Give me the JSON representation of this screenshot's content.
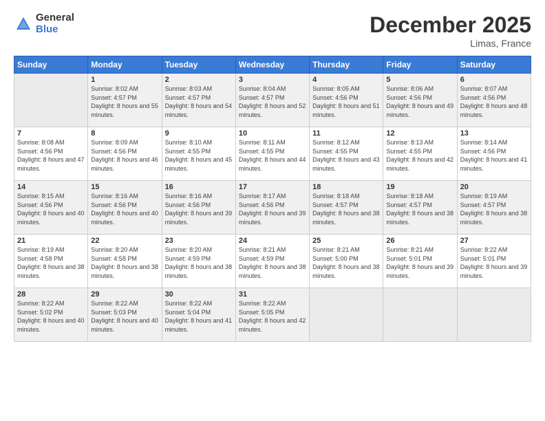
{
  "logo": {
    "general": "General",
    "blue": "Blue"
  },
  "header": {
    "month": "December 2025",
    "location": "Limas, France"
  },
  "weekdays": [
    "Sunday",
    "Monday",
    "Tuesday",
    "Wednesday",
    "Thursday",
    "Friday",
    "Saturday"
  ],
  "weeks": [
    [
      {
        "day": "",
        "sunrise": "",
        "sunset": "",
        "daylight": "",
        "empty": true
      },
      {
        "day": "1",
        "sunrise": "Sunrise: 8:02 AM",
        "sunset": "Sunset: 4:57 PM",
        "daylight": "Daylight: 8 hours and 55 minutes."
      },
      {
        "day": "2",
        "sunrise": "Sunrise: 8:03 AM",
        "sunset": "Sunset: 4:57 PM",
        "daylight": "Daylight: 8 hours and 54 minutes."
      },
      {
        "day": "3",
        "sunrise": "Sunrise: 8:04 AM",
        "sunset": "Sunset: 4:57 PM",
        "daylight": "Daylight: 8 hours and 52 minutes."
      },
      {
        "day": "4",
        "sunrise": "Sunrise: 8:05 AM",
        "sunset": "Sunset: 4:56 PM",
        "daylight": "Daylight: 8 hours and 51 minutes."
      },
      {
        "day": "5",
        "sunrise": "Sunrise: 8:06 AM",
        "sunset": "Sunset: 4:56 PM",
        "daylight": "Daylight: 8 hours and 49 minutes."
      },
      {
        "day": "6",
        "sunrise": "Sunrise: 8:07 AM",
        "sunset": "Sunset: 4:56 PM",
        "daylight": "Daylight: 8 hours and 48 minutes."
      }
    ],
    [
      {
        "day": "7",
        "sunrise": "Sunrise: 8:08 AM",
        "sunset": "Sunset: 4:56 PM",
        "daylight": "Daylight: 8 hours and 47 minutes."
      },
      {
        "day": "8",
        "sunrise": "Sunrise: 8:09 AM",
        "sunset": "Sunset: 4:56 PM",
        "daylight": "Daylight: 8 hours and 46 minutes."
      },
      {
        "day": "9",
        "sunrise": "Sunrise: 8:10 AM",
        "sunset": "Sunset: 4:55 PM",
        "daylight": "Daylight: 8 hours and 45 minutes."
      },
      {
        "day": "10",
        "sunrise": "Sunrise: 8:11 AM",
        "sunset": "Sunset: 4:55 PM",
        "daylight": "Daylight: 8 hours and 44 minutes."
      },
      {
        "day": "11",
        "sunrise": "Sunrise: 8:12 AM",
        "sunset": "Sunset: 4:55 PM",
        "daylight": "Daylight: 8 hours and 43 minutes."
      },
      {
        "day": "12",
        "sunrise": "Sunrise: 8:13 AM",
        "sunset": "Sunset: 4:55 PM",
        "daylight": "Daylight: 8 hours and 42 minutes."
      },
      {
        "day": "13",
        "sunrise": "Sunrise: 8:14 AM",
        "sunset": "Sunset: 4:56 PM",
        "daylight": "Daylight: 8 hours and 41 minutes."
      }
    ],
    [
      {
        "day": "14",
        "sunrise": "Sunrise: 8:15 AM",
        "sunset": "Sunset: 4:56 PM",
        "daylight": "Daylight: 8 hours and 40 minutes."
      },
      {
        "day": "15",
        "sunrise": "Sunrise: 8:16 AM",
        "sunset": "Sunset: 4:56 PM",
        "daylight": "Daylight: 8 hours and 40 minutes."
      },
      {
        "day": "16",
        "sunrise": "Sunrise: 8:16 AM",
        "sunset": "Sunset: 4:56 PM",
        "daylight": "Daylight: 8 hours and 39 minutes."
      },
      {
        "day": "17",
        "sunrise": "Sunrise: 8:17 AM",
        "sunset": "Sunset: 4:56 PM",
        "daylight": "Daylight: 8 hours and 39 minutes."
      },
      {
        "day": "18",
        "sunrise": "Sunrise: 8:18 AM",
        "sunset": "Sunset: 4:57 PM",
        "daylight": "Daylight: 8 hours and 38 minutes."
      },
      {
        "day": "19",
        "sunrise": "Sunrise: 8:18 AM",
        "sunset": "Sunset: 4:57 PM",
        "daylight": "Daylight: 8 hours and 38 minutes."
      },
      {
        "day": "20",
        "sunrise": "Sunrise: 8:19 AM",
        "sunset": "Sunset: 4:57 PM",
        "daylight": "Daylight: 8 hours and 38 minutes."
      }
    ],
    [
      {
        "day": "21",
        "sunrise": "Sunrise: 8:19 AM",
        "sunset": "Sunset: 4:58 PM",
        "daylight": "Daylight: 8 hours and 38 minutes."
      },
      {
        "day": "22",
        "sunrise": "Sunrise: 8:20 AM",
        "sunset": "Sunset: 4:58 PM",
        "daylight": "Daylight: 8 hours and 38 minutes."
      },
      {
        "day": "23",
        "sunrise": "Sunrise: 8:20 AM",
        "sunset": "Sunset: 4:59 PM",
        "daylight": "Daylight: 8 hours and 38 minutes."
      },
      {
        "day": "24",
        "sunrise": "Sunrise: 8:21 AM",
        "sunset": "Sunset: 4:59 PM",
        "daylight": "Daylight: 8 hours and 38 minutes."
      },
      {
        "day": "25",
        "sunrise": "Sunrise: 8:21 AM",
        "sunset": "Sunset: 5:00 PM",
        "daylight": "Daylight: 8 hours and 38 minutes."
      },
      {
        "day": "26",
        "sunrise": "Sunrise: 8:21 AM",
        "sunset": "Sunset: 5:01 PM",
        "daylight": "Daylight: 8 hours and 39 minutes."
      },
      {
        "day": "27",
        "sunrise": "Sunrise: 8:22 AM",
        "sunset": "Sunset: 5:01 PM",
        "daylight": "Daylight: 8 hours and 39 minutes."
      }
    ],
    [
      {
        "day": "28",
        "sunrise": "Sunrise: 8:22 AM",
        "sunset": "Sunset: 5:02 PM",
        "daylight": "Daylight: 8 hours and 40 minutes."
      },
      {
        "day": "29",
        "sunrise": "Sunrise: 8:22 AM",
        "sunset": "Sunset: 5:03 PM",
        "daylight": "Daylight: 8 hours and 40 minutes."
      },
      {
        "day": "30",
        "sunrise": "Sunrise: 8:22 AM",
        "sunset": "Sunset: 5:04 PM",
        "daylight": "Daylight: 8 hours and 41 minutes."
      },
      {
        "day": "31",
        "sunrise": "Sunrise: 8:22 AM",
        "sunset": "Sunset: 5:05 PM",
        "daylight": "Daylight: 8 hours and 42 minutes."
      },
      {
        "day": "",
        "sunrise": "",
        "sunset": "",
        "daylight": "",
        "empty": true
      },
      {
        "day": "",
        "sunrise": "",
        "sunset": "",
        "daylight": "",
        "empty": true
      },
      {
        "day": "",
        "sunrise": "",
        "sunset": "",
        "daylight": "",
        "empty": true
      }
    ]
  ]
}
